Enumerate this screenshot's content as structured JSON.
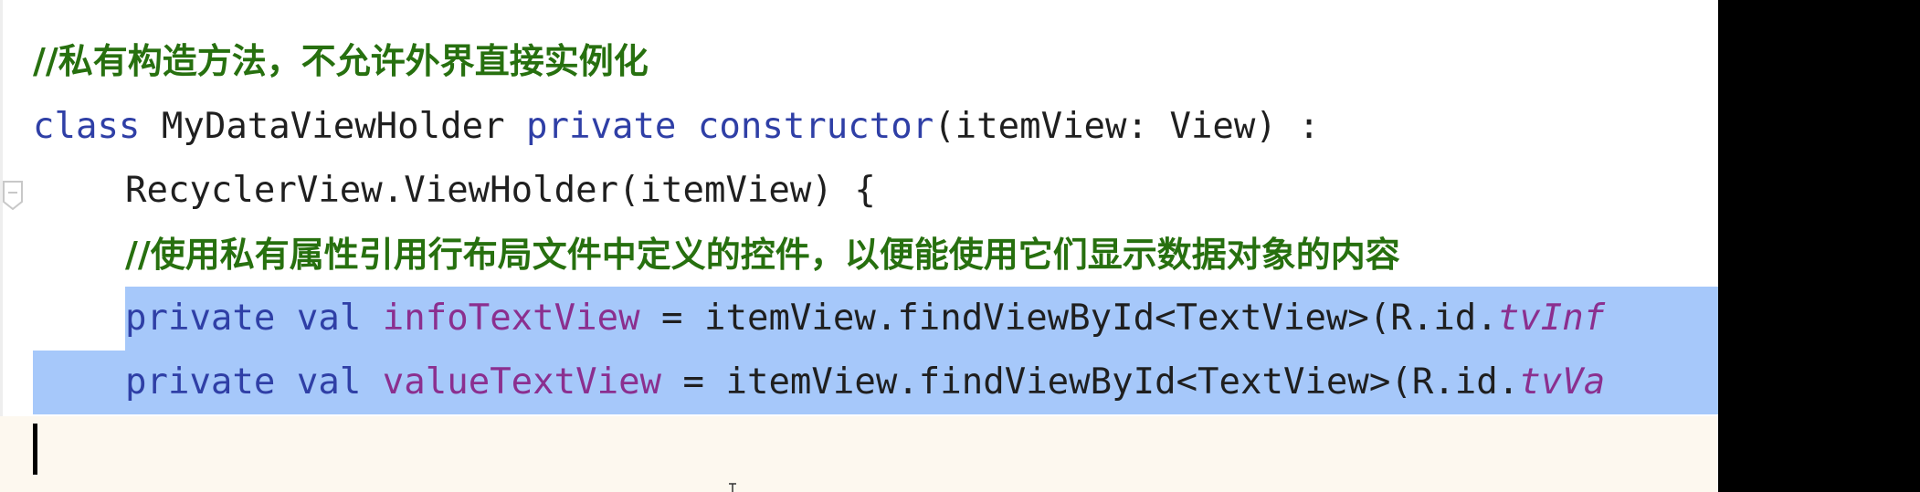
{
  "editor": {
    "lines": [
      {
        "comment": "//私有构造方法，不允许外界直接实例化"
      },
      {
        "kw1": "class",
        "t1": " MyDataViewHolder ",
        "kw2": "private",
        "t2": " ",
        "kw3": "constructor",
        "t3": "(itemView: View) :"
      },
      {
        "t1": "RecyclerView.ViewHolder(itemView) {"
      },
      {
        "comment": "//使用私有属性引用行布局文件中定义的控件，以便能使用它们显示数据对象的内容"
      },
      {
        "kw1": "private",
        "t1": " ",
        "kw2": "val",
        "t2": " ",
        "prop": "infoTextView",
        "t3": " = itemView.findViewById<TextView>(R.id.",
        "ital": "tvInf"
      },
      {
        "kw1": "private",
        "t1": " ",
        "kw2": "val",
        "t2": " ",
        "prop": "valueTextView",
        "t3": " = itemView.findViewById<TextView>(R.id.",
        "ital": "tvVa"
      }
    ]
  },
  "colors": {
    "selection": "#a6c8fa",
    "current_line": "#fdf8ef",
    "keyword": "#2f3fa6",
    "comment": "#27700f",
    "property": "#8b2f8f"
  },
  "icons": {
    "gutter": "fold-icon"
  }
}
